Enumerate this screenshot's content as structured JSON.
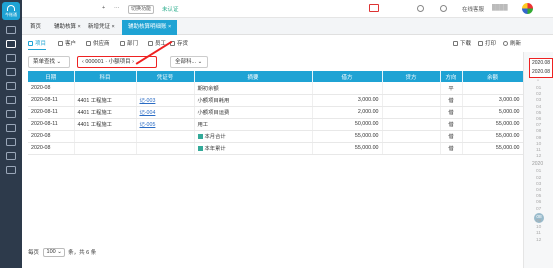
{
  "app": {
    "logo_label": "今账通"
  },
  "topbar": {
    "plus": "+",
    "dots": "···",
    "switch_label": "切换功能",
    "unverified": "未认证",
    "online_service": "在线客服",
    "user": "████"
  },
  "tabs": [
    {
      "label": "首页"
    },
    {
      "label": "辅助核算 ×"
    },
    {
      "label": "新增凭证 ×"
    },
    {
      "label": "辅助核算明细账 ×"
    }
  ],
  "subtabs": [
    {
      "label": "项目"
    },
    {
      "label": "客户"
    },
    {
      "label": "供应商"
    },
    {
      "label": "部门"
    },
    {
      "label": "员工"
    },
    {
      "label": "存货"
    }
  ],
  "actions": {
    "download": "下载",
    "print": "打印",
    "refresh": "刷新"
  },
  "filters": {
    "view_label": "菜单查找",
    "account_label": "000001 · 小额项目",
    "scope_label": "全部科..."
  },
  "table": {
    "columns": [
      "日期",
      "科目",
      "凭证号",
      "摘要",
      "借方",
      "贷方",
      "方向",
      "余额"
    ],
    "rows": [
      {
        "date": "2020-08",
        "subject": "",
        "voucher": "",
        "summary": "期初余额",
        "debit": "",
        "credit": "",
        "dir": "平",
        "balance": "",
        "tick": false
      },
      {
        "date": "2020-08-11",
        "subject": "4401 工程施工",
        "voucher": "记-003",
        "summary": "小额项目耗用",
        "debit": "3,000.00",
        "credit": "",
        "dir": "借",
        "balance": "3,000.00",
        "tick": false
      },
      {
        "date": "2020-08-11",
        "subject": "4401 工程施工",
        "voucher": "记-004",
        "summary": "小额项目运费",
        "debit": "2,000.00",
        "credit": "",
        "dir": "借",
        "balance": "5,000.00",
        "tick": false
      },
      {
        "date": "2020-08-11",
        "subject": "4401 工程施工",
        "voucher": "记-005",
        "summary": "用工",
        "debit": "50,000.00",
        "credit": "",
        "dir": "借",
        "balance": "55,000.00",
        "tick": false
      },
      {
        "date": "2020-08",
        "subject": "",
        "voucher": "",
        "summary": "本月合计",
        "debit": "55,000.00",
        "credit": "",
        "dir": "借",
        "balance": "55,000.00",
        "tick": true
      },
      {
        "date": "2020-08",
        "subject": "",
        "voucher": "",
        "summary": "本年累计",
        "debit": "55,000.00",
        "credit": "",
        "dir": "借",
        "balance": "55,000.00",
        "tick": true
      }
    ]
  },
  "footer": {
    "prefix": "每页",
    "page_size": "100",
    "suffix": "条，共 6 条"
  },
  "period": {
    "start": "2020.08",
    "end": "2020.08",
    "years": [
      "2020"
    ],
    "months_top": [
      "01",
      "02",
      "03",
      "04",
      "05",
      "06",
      "07",
      "08",
      "09",
      "10",
      "11",
      "12"
    ],
    "months_bottom": [
      "01",
      "02",
      "03",
      "04",
      "05",
      "06",
      "07",
      "08",
      "09",
      "10",
      "11",
      "12"
    ],
    "current_year": "2020"
  },
  "colors": {
    "accent": "#1fa3d4",
    "highlight": "#e22222",
    "sidebar": "#2d3a4b"
  }
}
